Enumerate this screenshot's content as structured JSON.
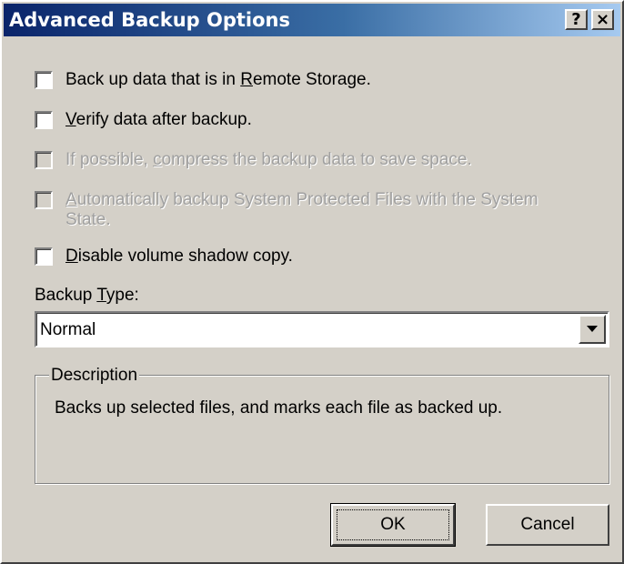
{
  "window": {
    "title": "Advanced Backup Options",
    "help_label": "?",
    "close_label": "×"
  },
  "options": [
    {
      "pre": "Back up data that is in ",
      "key": "R",
      "post": "emote Storage.",
      "checked": false,
      "disabled": false
    },
    {
      "pre": "",
      "key": "V",
      "post": "erify data after backup.",
      "checked": false,
      "disabled": false
    },
    {
      "pre": "If possible, ",
      "key": "c",
      "post": "ompress the backup data to save space.",
      "checked": false,
      "disabled": true
    },
    {
      "pre": "",
      "key": "A",
      "post": "utomatically backup System Protected Files with the System",
      "post2": "State.",
      "checked": false,
      "disabled": true
    },
    {
      "pre": "",
      "key": "D",
      "post": "isable volume shadow copy.",
      "checked": false,
      "disabled": false
    }
  ],
  "backup_type": {
    "label_pre": "Backup ",
    "label_key": "T",
    "label_post": "ype:",
    "selected": "Normal"
  },
  "description": {
    "legend": "Description",
    "text": "Backs up selected files, and marks each file as backed up."
  },
  "buttons": {
    "ok": "OK",
    "cancel": "Cancel"
  }
}
